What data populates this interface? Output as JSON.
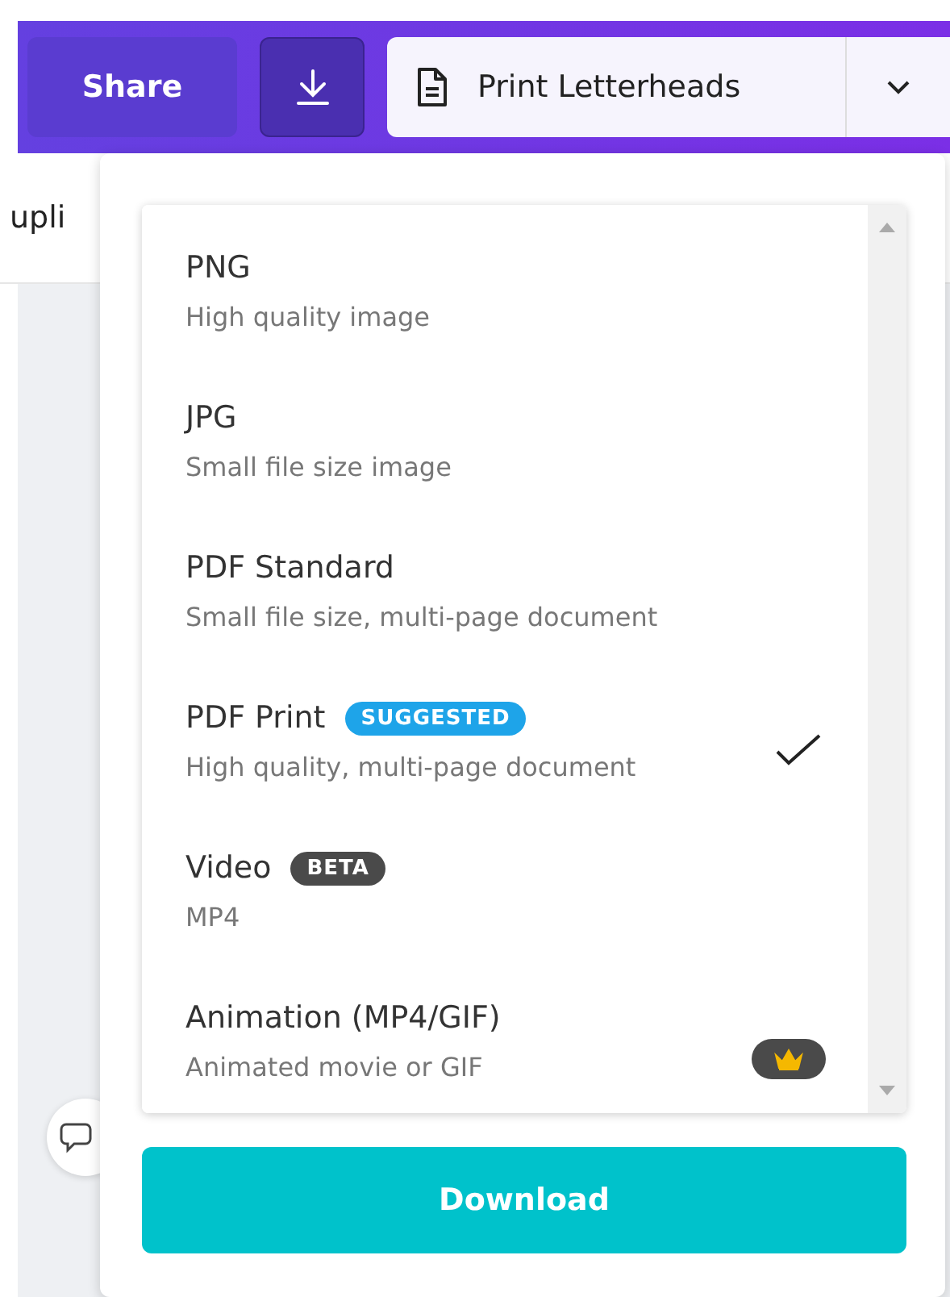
{
  "toolbar": {
    "share_label": "Share",
    "design_title": "Print Letterheads"
  },
  "background": {
    "menu_text": "upli"
  },
  "formats": [
    {
      "title": "PNG",
      "subtitle": "High quality image",
      "selected": false,
      "premium": false
    },
    {
      "title": "JPG",
      "subtitle": "Small file size image",
      "selected": false,
      "premium": false
    },
    {
      "title": "PDF Standard",
      "subtitle": "Small file size, multi-page document",
      "selected": false,
      "premium": false
    },
    {
      "title": "PDF Print",
      "subtitle": "High quality, multi-page document",
      "selected": true,
      "premium": false,
      "badge": {
        "text": "SUGGESTED",
        "kind": "suggested"
      }
    },
    {
      "title": "Video",
      "subtitle": "MP4",
      "selected": false,
      "premium": false,
      "badge": {
        "text": "BETA",
        "kind": "beta"
      }
    },
    {
      "title": "Animation (MP4/GIF)",
      "subtitle": "Animated movie or GIF",
      "selected": false,
      "premium": true
    }
  ],
  "download_button": "Download"
}
